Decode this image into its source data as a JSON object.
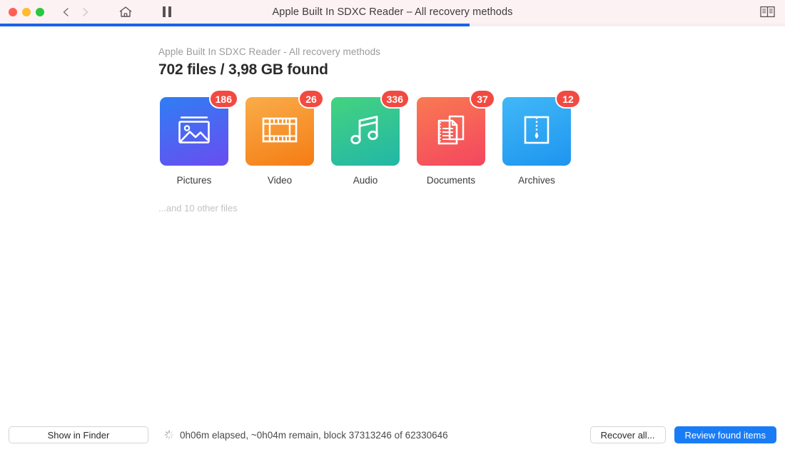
{
  "titlebar": {
    "title": "Apple Built In SDXC Reader – All recovery methods",
    "traffic_lights": [
      {
        "name": "close",
        "color": "#ff5f57"
      },
      {
        "name": "minimize",
        "color": "#febc2e"
      },
      {
        "name": "zoom",
        "color": "#28c840"
      }
    ],
    "back_icon": "chevron-left-icon",
    "forward_icon": "chevron-right-icon",
    "home_icon": "home-icon",
    "pause_icon": "pause-icon",
    "view_icon": "book-view-icon",
    "background_color": "#fdf2f3"
  },
  "progress": {
    "percent": 59.8,
    "fill_color": "#1a62f0",
    "track_color": "#f6eef0"
  },
  "main": {
    "subtitle": "Apple Built In SDXC Reader - All recovery methods",
    "headline": "702 files / 3,98 GB found",
    "other_files_note": "...and 10 other files",
    "categories": [
      {
        "label": "Pictures",
        "count": "186",
        "icon": "image-icon",
        "gradient_from": "#2f7ef3",
        "gradient_to": "#6a4df0"
      },
      {
        "label": "Video",
        "count": "26",
        "icon": "film-strip-icon",
        "gradient_from": "#f9ad4a",
        "gradient_to": "#f57c14"
      },
      {
        "label": "Audio",
        "count": "336",
        "icon": "music-note-icon",
        "gradient_from": "#44d37f",
        "gradient_to": "#22b6a8"
      },
      {
        "label": "Documents",
        "count": "37",
        "icon": "documents-icon",
        "gradient_from": "#f97a52",
        "gradient_to": "#f4465f"
      },
      {
        "label": "Archives",
        "count": "12",
        "icon": "archive-zip-icon",
        "gradient_from": "#41b8f7",
        "gradient_to": "#1e95ef"
      }
    ],
    "badge_color": "#f24a41"
  },
  "bottombar": {
    "show_in_finder_label": "Show in Finder",
    "status_icon": "spinner-icon",
    "status_text": "0h06m elapsed, ~0h04m remain, block 37313246 of 62330646",
    "recover_all_label": "Recover all...",
    "review_found_items_label": "Review found items",
    "primary_color": "#1a7cf5"
  }
}
